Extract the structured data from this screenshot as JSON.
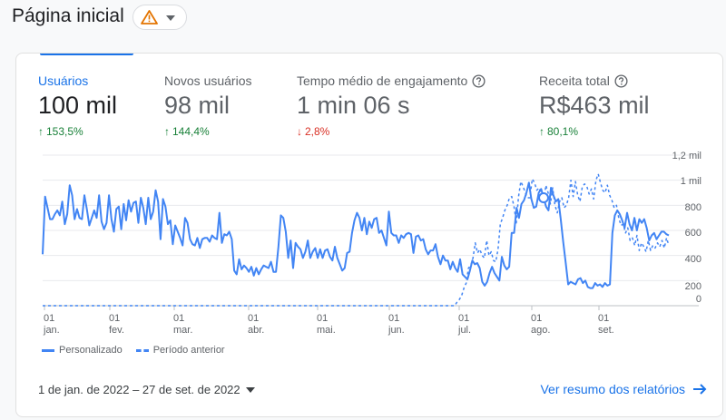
{
  "page": {
    "title": "Página inicial"
  },
  "metrics": [
    {
      "label": "Usuários",
      "value": "100 mil",
      "change": "153,5%",
      "direction": "up",
      "help": false,
      "active": true
    },
    {
      "label": "Novos usuários",
      "value": "98 mil",
      "change": "144,4%",
      "direction": "up",
      "help": false,
      "active": false
    },
    {
      "label": "Tempo médio de engajamento",
      "value": "1 min 06 s",
      "change": "2,8%",
      "direction": "down",
      "help": true,
      "active": false
    },
    {
      "label": "Receita total",
      "value": "R$463 mil",
      "change": "80,1%",
      "direction": "up",
      "help": true,
      "active": false
    }
  ],
  "chart_data": {
    "type": "line",
    "x_tick_labels": [
      [
        "01",
        "jan."
      ],
      [
        "01",
        "fev."
      ],
      [
        "01",
        "mar."
      ],
      [
        "01",
        "abr."
      ],
      [
        "01",
        "mai."
      ],
      [
        "01",
        "jun."
      ],
      [
        "01",
        "jul."
      ],
      [
        "01",
        "ago."
      ],
      [
        "01",
        "set."
      ]
    ],
    "y_ticks": [
      "0",
      "200",
      "400",
      "600",
      "800",
      "1 mil",
      "1,2 mil"
    ],
    "ylim": [
      0,
      1200
    ],
    "series": [
      {
        "name": "Personalizado",
        "style": "solid",
        "values": [
          410,
          870,
          780,
          690,
          690,
          730,
          760,
          720,
          830,
          650,
          730,
          960,
          880,
          690,
          770,
          700,
          690,
          880,
          770,
          640,
          700,
          760,
          700,
          880,
          670,
          610,
          660,
          880,
          690,
          590,
          770,
          790,
          610,
          810,
          680,
          840,
          750,
          820,
          830,
          660,
          860,
          780,
          650,
          860,
          690,
          750,
          920,
          830,
          530,
          850,
          790,
          650,
          680,
          490,
          640,
          590,
          540,
          480,
          700,
          660,
          530,
          490,
          480,
          540,
          460,
          530,
          540,
          540,
          510,
          560,
          540,
          530,
          740,
          500,
          570,
          560,
          590,
          530,
          280,
          250,
          370,
          290,
          320,
          300,
          270,
          310,
          240,
          300,
          250,
          290,
          320,
          310,
          300,
          350,
          270,
          270,
          470,
          720,
          700,
          590,
          380,
          520,
          300,
          500,
          470,
          450,
          380,
          430,
          520,
          380,
          430,
          460,
          380,
          450,
          380,
          440,
          450,
          390,
          360,
          470,
          380,
          330,
          280,
          300,
          420,
          430,
          580,
          680,
          740,
          700,
          600,
          700,
          570,
          670,
          620,
          690,
          700,
          580,
          600,
          540,
          480,
          750,
          580,
          560,
          560,
          500,
          560,
          540,
          570,
          580,
          570,
          420,
          550,
          560,
          520,
          530,
          450,
          410,
          440,
          440,
          490,
          390,
          330,
          400,
          360,
          360,
          290,
          350,
          300,
          270,
          370,
          250,
          230,
          210,
          280,
          360,
          330,
          340,
          300,
          190,
          160,
          190,
          260,
          310,
          260,
          230,
          200,
          390,
          320,
          290,
          310,
          580,
          580,
          780,
          700,
          810,
          840,
          900,
          980,
          850,
          780,
          790,
          900,
          930,
          860,
          790,
          760,
          940,
          880,
          830,
          850,
          690,
          510,
          340,
          170,
          190,
          180,
          170,
          210,
          220,
          180,
          200,
          150,
          140,
          140,
          180,
          160,
          170,
          150,
          180,
          160,
          170,
          580,
          720,
          760,
          730,
          680,
          620,
          740,
          650,
          600,
          700,
          600,
          690,
          660,
          690,
          620,
          520,
          560,
          580,
          530,
          560,
          590,
          590,
          570,
          560
        ]
      },
      {
        "name": "Período anterior",
        "style": "dashed",
        "values": [
          0,
          0,
          0,
          0,
          0,
          0,
          0,
          0,
          0,
          0,
          0,
          0,
          0,
          0,
          0,
          0,
          0,
          0,
          0,
          0,
          0,
          0,
          0,
          0,
          0,
          0,
          0,
          0,
          0,
          0,
          0,
          0,
          0,
          0,
          0,
          0,
          0,
          0,
          0,
          0,
          0,
          0,
          0,
          0,
          0,
          0,
          0,
          0,
          0,
          0,
          0,
          0,
          0,
          0,
          0,
          0,
          0,
          0,
          0,
          0,
          0,
          0,
          0,
          0,
          0,
          0,
          0,
          0,
          0,
          0,
          0,
          0,
          0,
          0,
          0,
          0,
          0,
          0,
          0,
          0,
          0,
          0,
          0,
          0,
          0,
          0,
          0,
          0,
          0,
          0,
          0,
          0,
          0,
          0,
          0,
          0,
          0,
          0,
          0,
          0,
          0,
          0,
          0,
          0,
          0,
          0,
          0,
          0,
          0,
          0,
          0,
          0,
          0,
          0,
          0,
          0,
          0,
          0,
          0,
          0,
          0,
          0,
          0,
          0,
          0,
          0,
          0,
          0,
          0,
          0,
          0,
          0,
          0,
          0,
          0,
          0,
          0,
          0,
          0,
          0,
          0,
          0,
          0,
          0,
          0,
          0,
          0,
          0,
          0,
          0,
          0,
          0,
          0,
          0,
          0,
          0,
          0,
          0,
          0,
          0,
          0,
          0,
          0,
          0,
          0,
          0,
          0,
          0,
          0,
          0,
          0,
          0,
          0,
          0,
          0,
          0,
          0,
          0,
          0,
          0,
          0,
          0,
          30,
          50,
          80,
          140,
          180,
          300,
          320,
          380,
          500,
          420,
          450,
          400,
          380,
          520,
          400,
          430,
          360,
          350,
          450,
          650,
          700,
          760,
          800,
          860,
          870,
          790,
          660,
          870,
          990,
          950,
          900,
          860,
          860,
          1010,
          980,
          920,
          940,
          880,
          820,
          960,
          900,
          810,
          940,
          800,
          740,
          830,
          860,
          780,
          800,
          860,
          1000,
          870,
          990,
          880,
          830,
          950,
          970,
          950,
          890,
          930,
          850,
          1000,
          1050,
          980,
          920,
          900,
          960,
          880,
          840,
          780,
          800,
          700,
          640,
          650,
          580,
          620,
          520,
          540,
          480,
          560,
          440,
          500,
          470,
          430,
          520,
          440,
          480,
          460,
          500,
          470,
          520,
          460,
          540,
          480
        ]
      }
    ]
  },
  "legend": {
    "series1": "Personalizado",
    "series2": "Período anterior"
  },
  "footer": {
    "date_range": "1 de jan. de 2022 – 27 de set. de 2022",
    "view_link": "Ver resumo dos relatórios"
  },
  "colors": {
    "accent": "#1a73e8",
    "line": "#4285f4",
    "up": "#188038",
    "down": "#d93025",
    "warning": "#e37400"
  },
  "icons": {
    "warning": "warning-icon",
    "caret": "caret-down-icon",
    "help": "help-circle-icon",
    "arrow": "arrow-right-icon"
  }
}
